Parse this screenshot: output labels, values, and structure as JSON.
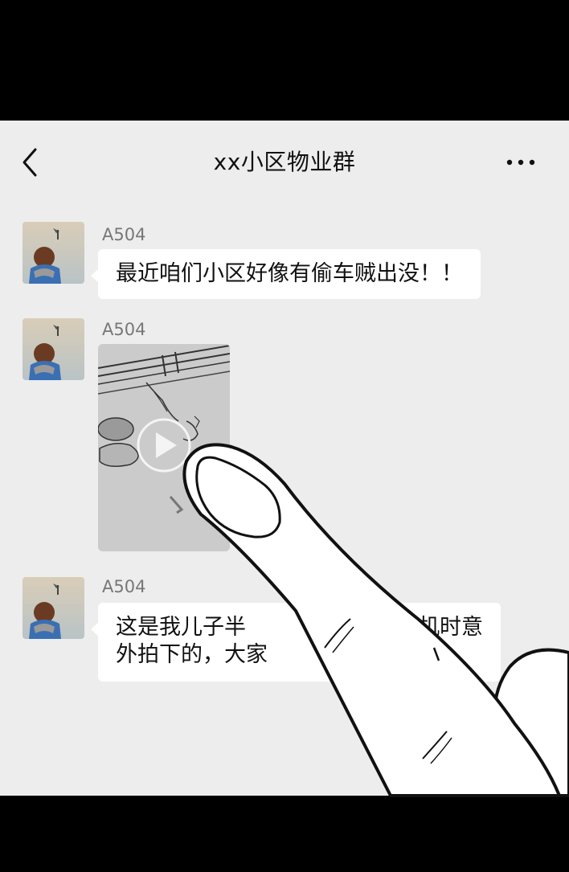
{
  "chat": {
    "title": "xx小区物业群"
  },
  "messages": [
    {
      "sender": "A504",
      "type": "text",
      "text": "最近咱们小区好像有偷车贼出没！！"
    },
    {
      "sender": "A504",
      "type": "video"
    },
    {
      "sender": "A504",
      "type": "text",
      "line1_left": "这是我儿子半",
      "line1_right": "机时意",
      "line2_left": "外拍下的，大家"
    }
  ],
  "icons": {
    "back": "chevron-left-icon",
    "more": "more-dots-icon",
    "play": "play-icon"
  },
  "colors": {
    "chat_bg": "#ededed",
    "bubble_bg": "#ffffff",
    "frame_bg": "#000000"
  }
}
